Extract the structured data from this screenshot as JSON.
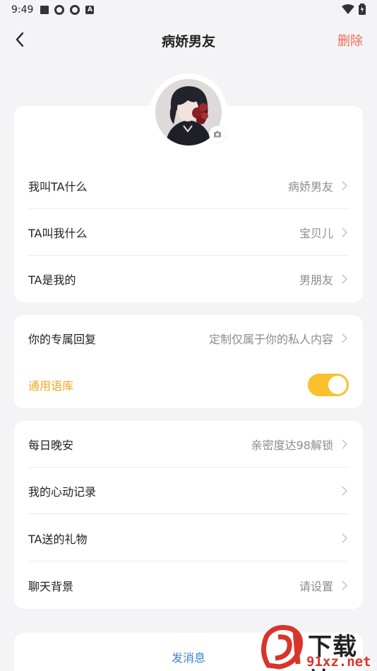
{
  "status_bar": {
    "time": "9:49"
  },
  "header": {
    "title": "病娇男友",
    "delete_label": "删除"
  },
  "profile": {
    "rows": [
      {
        "label": "我叫TA什么",
        "value": "病娇男友"
      },
      {
        "label": "TA叫我什么",
        "value": "宝贝儿"
      },
      {
        "label": "TA是我的",
        "value": "男朋友"
      }
    ]
  },
  "reply": {
    "exclusive_label": "你的专属回复",
    "exclusive_value": "定制仅属于你的私人内容",
    "general_label": "通用语库",
    "general_enabled": true
  },
  "features": {
    "rows": [
      {
        "label": "每日晚安",
        "value": "亲密度达98解锁"
      },
      {
        "label": "我的心动记录",
        "value": ""
      },
      {
        "label": "TA送的礼物",
        "value": ""
      },
      {
        "label": "聊天背景",
        "value": "请设置"
      }
    ]
  },
  "send_label": "发消息",
  "watermark": {
    "title": "下载站",
    "url": "91xz.net"
  },
  "colors": {
    "accent": "#f06a55",
    "toggle": "#fbc02d",
    "general": "#f5a623",
    "link": "#3a7fd9"
  }
}
